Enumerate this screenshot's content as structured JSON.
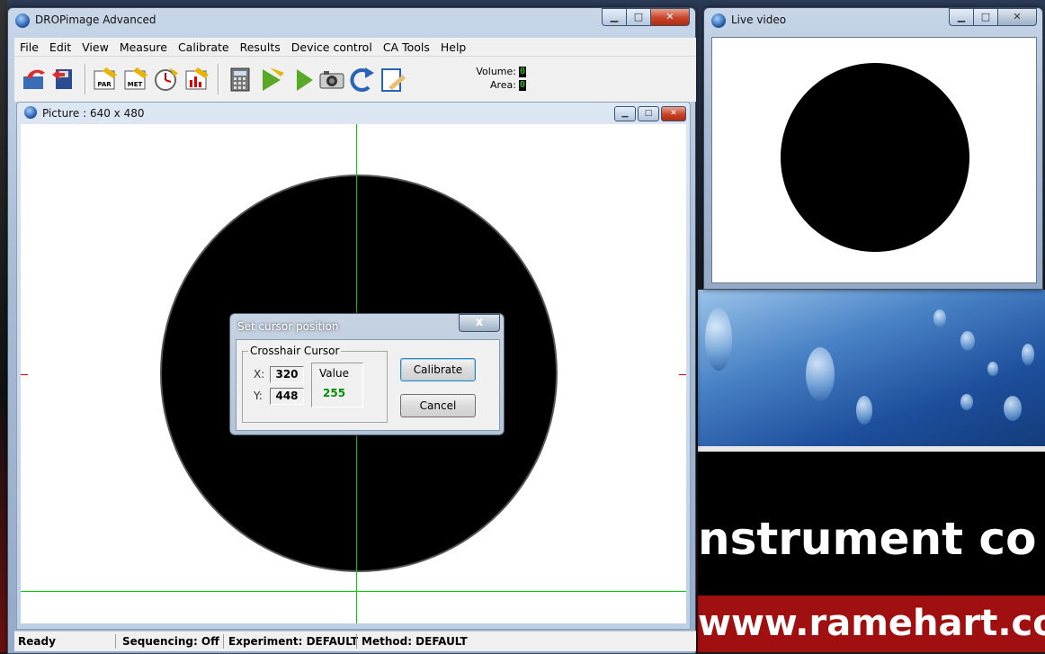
{
  "main_window": {
    "title": "DROPimage Advanced",
    "menu": [
      "File",
      "Edit",
      "View",
      "Measure",
      "Calibrate",
      "Results",
      "Device control",
      "CA Tools",
      "Help"
    ],
    "toolbar": {
      "icons": [
        "open-icon",
        "save-icon",
        "par-icon",
        "met-icon",
        "timer-icon",
        "chart-icon",
        "calculator-icon",
        "run-arrow-icon",
        "play-icon",
        "camera-icon",
        "rotate-icon",
        "clipboard-icon"
      ],
      "par_text": "PAR",
      "met_text": "MET",
      "volume_label": "Volume:",
      "volume_value": "0",
      "area_label": "Area:",
      "area_value": "0"
    },
    "status": {
      "ready": "Ready",
      "sequencing": "Sequencing: Off",
      "experiment": "Experiment: DEFAULT",
      "method": "Method: DEFAULT"
    }
  },
  "picture_window": {
    "title": "Picture : 640 x 480"
  },
  "dialog": {
    "title": "Set cursor position",
    "close_label": "x",
    "group_label": "Crosshair Cursor",
    "x_label": "X:",
    "x_value": "320",
    "y_label": "Y:",
    "y_value": "448",
    "value_label": "Value",
    "value": "255",
    "calibrate_label": "Calibrate",
    "cancel_label": "Cancel"
  },
  "live_window": {
    "title": "Live video"
  },
  "background": {
    "brand_text": "nstrument co",
    "url_text": "www.ramehart.co"
  },
  "colors": {
    "crosshair": "#00d000",
    "marker": "#e00000",
    "value_green": "#0a8a0a"
  }
}
